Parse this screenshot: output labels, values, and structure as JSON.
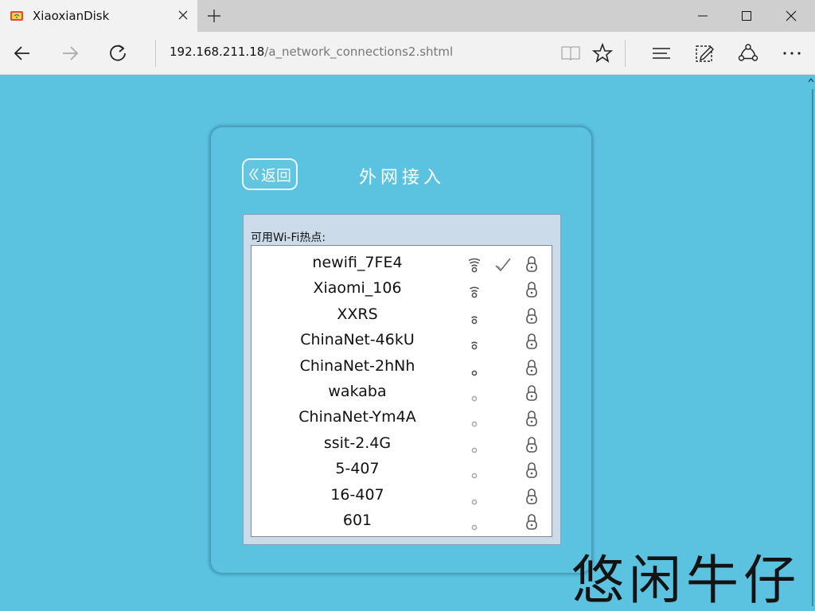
{
  "browser": {
    "tab_title": "XiaoxianDisk",
    "url_host": "192.168.211.18",
    "url_path": "/a_network_connections2.shtml"
  },
  "page": {
    "back_label": "返回",
    "title": "外网接入",
    "list_label": "可用Wi-Fi热点:"
  },
  "networks": [
    {
      "ssid": "newifi_7FE4",
      "signal": 4,
      "connected": true,
      "locked": true
    },
    {
      "ssid": "Xiaomi_106",
      "signal": 3,
      "connected": false,
      "locked": true
    },
    {
      "ssid": "XXRS",
      "signal": 2,
      "connected": false,
      "locked": true
    },
    {
      "ssid": "ChinaNet-46kU",
      "signal": 2,
      "connected": false,
      "locked": true
    },
    {
      "ssid": "ChinaNet-2hNh",
      "signal": 1,
      "connected": false,
      "locked": true
    },
    {
      "ssid": "wakaba",
      "signal": 0,
      "connected": false,
      "locked": true
    },
    {
      "ssid": "ChinaNet-Ym4A",
      "signal": 0,
      "connected": false,
      "locked": true
    },
    {
      "ssid": "ssit-2.4G",
      "signal": 0,
      "connected": false,
      "locked": true
    },
    {
      "ssid": "5-407",
      "signal": 0,
      "connected": false,
      "locked": true
    },
    {
      "ssid": "16-407",
      "signal": 0,
      "connected": false,
      "locked": true
    },
    {
      "ssid": "601",
      "signal": 0,
      "connected": false,
      "locked": true
    }
  ],
  "watermark": "悠闲牛仔",
  "colors": {
    "page_bg": "#5bc3e0",
    "panel_bg": "#ccdbea",
    "icon_dark": "#555555",
    "icon_light": "#aaaaaa"
  }
}
